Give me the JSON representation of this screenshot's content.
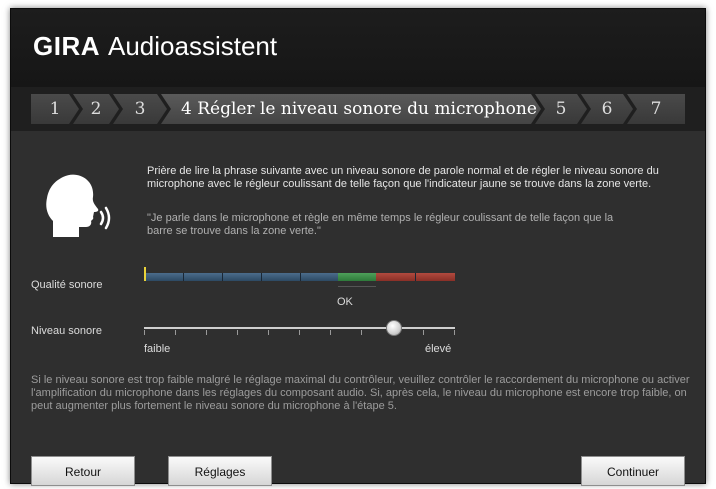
{
  "header": {
    "brand": "GIRA",
    "app_name": "Audioassistent"
  },
  "steps": [
    {
      "label": "1"
    },
    {
      "label": "2"
    },
    {
      "label": "3"
    },
    {
      "label": "4   Régler le niveau sonore du microphone"
    },
    {
      "label": "5"
    },
    {
      "label": "6"
    },
    {
      "label": "7"
    }
  ],
  "content": {
    "speaker_icon": "speaking-head-icon",
    "instruction": "Prière de lire la phrase suivante avec un niveau sonore de parole normal et de régler le niveau sonore du microphone avec le régleur coulissant de telle façon que l'indicateur jaune se trouve dans la zone verte.",
    "quote": "\"Je parle dans le microphone et règle en même temps le régleur coulissant de telle façon que la barre se trouve dans la zone verte.\"",
    "quality_label": "Qualité sonore",
    "quality_zone_label": "OK",
    "quality_level": 0.0,
    "level_label": "Niveau sonore",
    "level_min_label": "faible",
    "level_max_label": "élevé",
    "level_value": 0.8,
    "help_text": "Si le niveau sonore est trop faible malgré le réglage maximal du contrôleur, veuillez contrôler le raccordement du microphone ou activer l'amplification du microphone dans les réglages du composant audio. Si, après cela, le niveau du microphone est encore trop faible, on peut augmenter plus fortement le niveau sonore du microphone à l'étape 5."
  },
  "buttons": {
    "back": "Retour",
    "settings": "Réglages",
    "continue": "Continuer"
  },
  "colors": {
    "meter_blue": "#3a5a78",
    "meter_green": "#3e8f4a",
    "meter_red": "#a33c31",
    "indicator_yellow": "#e9d23a"
  }
}
